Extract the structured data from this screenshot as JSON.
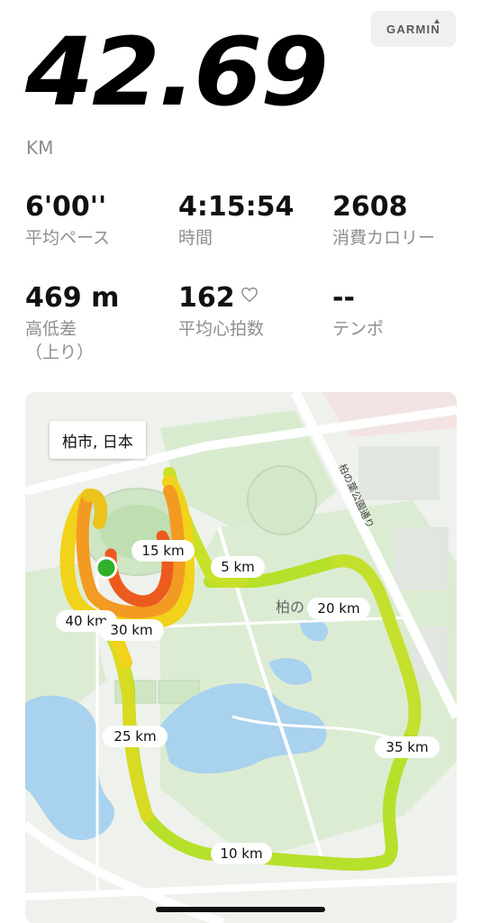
{
  "summary": {
    "distance": "42.69",
    "unit": "KM"
  },
  "brand": {
    "name": "GARMIN"
  },
  "stats": [
    {
      "value": "6'00''",
      "label": "平均ペース"
    },
    {
      "value": "4:15:54",
      "label": "時間"
    },
    {
      "value": "2608",
      "label": "消費カロリー"
    },
    {
      "value": "469 m",
      "label": "高低差\n（上り）"
    },
    {
      "value": "162",
      "label": "平均心拍数",
      "icon": "heart-outline-icon"
    },
    {
      "value": "--",
      "label": "テンポ"
    }
  ],
  "map": {
    "location": "柏市, 日本",
    "park_label": "柏の",
    "road_label": "柏の葉公園通り",
    "km_markers": [
      "5 km",
      "10 km",
      "15 km",
      "20 km",
      "25 km",
      "30 km",
      "35 km",
      "40 km"
    ],
    "colors": {
      "fast": "#b7e02a",
      "medium": "#f0d31a",
      "slow": "#f39a22",
      "slowest": "#ec5b1e",
      "start": "#30b02a",
      "water": "#a9d2ee",
      "park": "#d8ebcf"
    }
  }
}
